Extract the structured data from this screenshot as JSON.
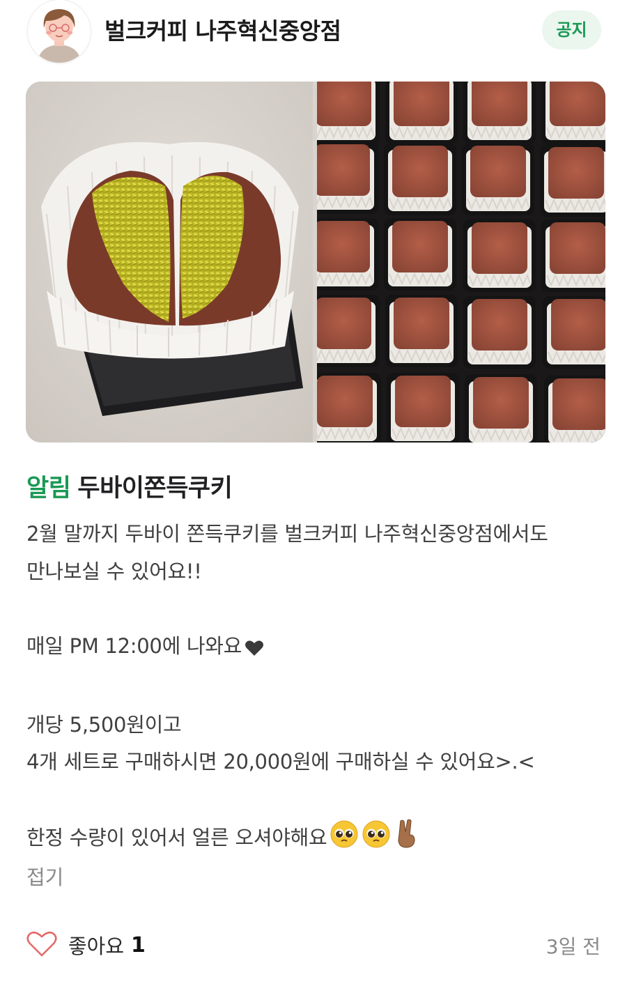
{
  "header": {
    "store_name": "벌크커피 나주혁신중앙점",
    "badge": "공지"
  },
  "images": [
    {
      "icon": "dubai-cookie-photo"
    },
    {
      "icon": "cookie-tray-photo"
    }
  ],
  "post": {
    "tag": "알림",
    "title": "두바이쫀득쿠키",
    "lines": [
      "2월 말까지 두바이 쫀득쿠키를 벌크커피 나주혁신중앙점에서도",
      "만나보실 수 있어요!!",
      "",
      "매일 PM 12:00에 나와요",
      "",
      "개당 5,500원이고",
      "4개 세트로 구매하시면 20,000원에 구매하실 수 있어요>.<",
      "",
      "한정 수량이 있어서 얼른 오셔야해요"
    ],
    "fold_label": "접기"
  },
  "footer": {
    "like_label": "좋아요",
    "like_count": "1",
    "time": "3일 전"
  },
  "colors": {
    "accent": "#1a9954",
    "badge_bg": "#eaf6ee"
  }
}
